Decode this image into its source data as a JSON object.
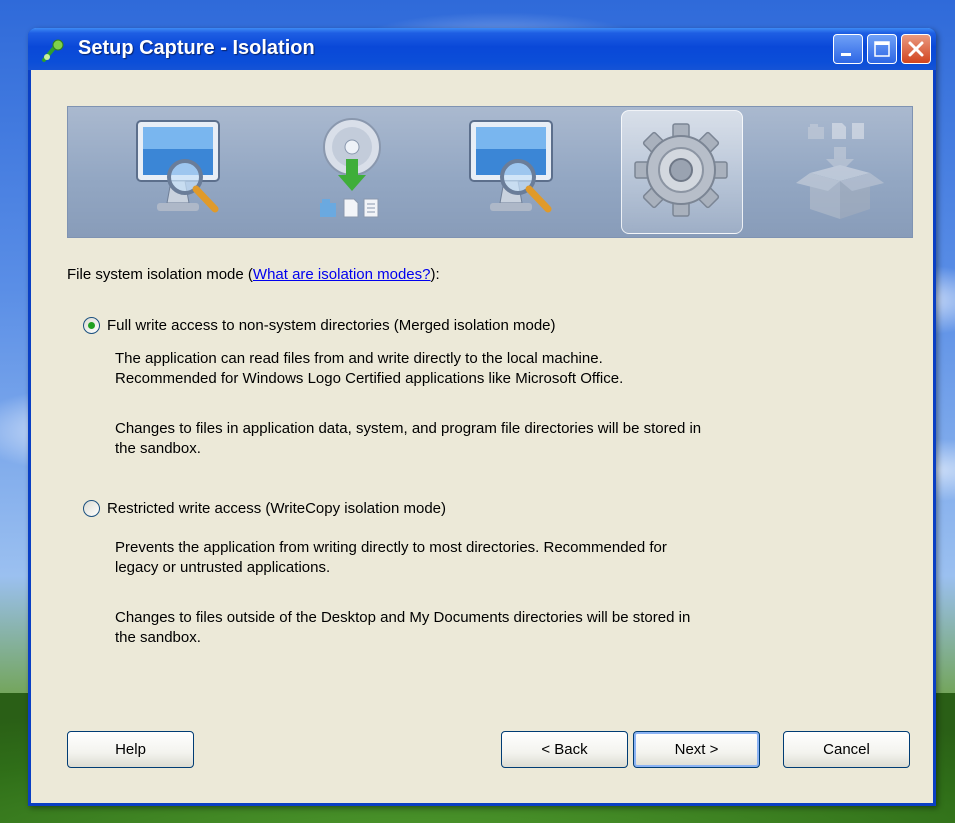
{
  "window": {
    "title": "Setup Capture - Isolation",
    "icons": [
      "app-icon",
      "minimize-icon",
      "maximize-icon",
      "close-icon"
    ]
  },
  "banner": {
    "steps": [
      {
        "icon": "monitor-magnifier-icon",
        "active": false
      },
      {
        "icon": "disc-install-icon",
        "active": false
      },
      {
        "icon": "monitor-magnifier-icon",
        "active": false
      },
      {
        "icon": "gear-icon",
        "active": true
      },
      {
        "icon": "package-box-icon",
        "active": false
      }
    ]
  },
  "isolation": {
    "label_prefix": "File system isolation mode (",
    "link_text": "What are isolation modes?",
    "label_suffix": "):",
    "options": [
      {
        "label": "Full write access to non-system directories (Merged isolation mode)",
        "selected": true,
        "desc1_line1": "The application can read files from and write directly to the local machine.",
        "desc1_line2": "Recommended for Windows Logo Certified applications like Microsoft Office.",
        "desc2_line1": "Changes to files in application data, system, and program file directories will be stored in",
        "desc2_line2": "the sandbox."
      },
      {
        "label": "Restricted write access (WriteCopy isolation mode)",
        "selected": false,
        "desc1_line1": "Prevents the application from writing directly to most directories. Recommended for",
        "desc1_line2": "legacy or untrusted applications.",
        "desc2_line1": "Changes to files outside of the Desktop and My Documents directories will be stored in",
        "desc2_line2": "the sandbox."
      }
    ]
  },
  "buttons": {
    "help": "Help",
    "back": "< Back",
    "next": "Next >",
    "cancel": "Cancel"
  },
  "colors": {
    "title_bar": "#0a48d8",
    "dialog_bg": "#ece9d8",
    "radio_selected": "#21a121",
    "link": "#0000ee"
  }
}
